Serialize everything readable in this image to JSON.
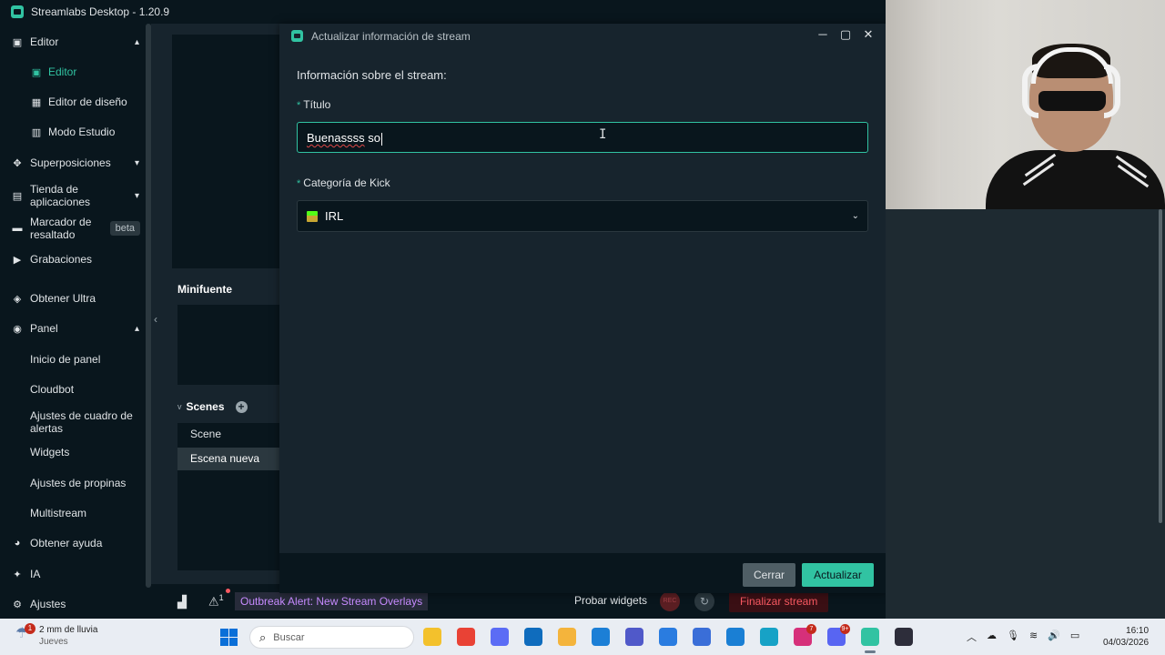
{
  "app": {
    "title": "Streamlabs Desktop - 1.20.9"
  },
  "sidebar": {
    "items": [
      {
        "label": "Editor",
        "icon": "editor-icon",
        "chevron": "▴"
      },
      {
        "label": "Editor",
        "icon": "editor-icon",
        "active": true
      },
      {
        "label": "Editor de diseño",
        "icon": "layout-icon"
      },
      {
        "label": "Modo Estudio",
        "icon": "studio-mode-icon"
      },
      {
        "label": "Superposiciones",
        "icon": "overlays-icon",
        "chevron": "▾"
      },
      {
        "label": "Tienda de aplicaciones",
        "icon": "app-store-icon",
        "chevron": "▾"
      },
      {
        "label": "Marcador de resaltado",
        "icon": "highlighter-icon",
        "badge": "beta"
      },
      {
        "label": "Grabaciones",
        "icon": "recordings-icon"
      },
      {
        "label": "Obtener Ultra",
        "icon": "ultra-icon"
      },
      {
        "label": "Panel",
        "icon": "dashboard-icon",
        "chevron": "▴"
      },
      {
        "label": "Inicio de panel"
      },
      {
        "label": "Cloudbot"
      },
      {
        "label": "Ajustes de cuadro de alertas"
      },
      {
        "label": "Widgets"
      },
      {
        "label": "Ajustes de propinas"
      },
      {
        "label": "Multistream"
      },
      {
        "label": "Obtener ayuda",
        "icon": "help-icon"
      },
      {
        "label": "IA",
        "icon": "ai-sparkle-icon"
      },
      {
        "label": "Ajustes",
        "icon": "settings-gear-icon"
      }
    ]
  },
  "editor": {
    "minifuente_title": "Minifuente",
    "scenes_title": "Scenes",
    "scenes": [
      "Scene",
      "Escena nueva"
    ],
    "selected_scene": "Escena nueva"
  },
  "footer": {
    "alert_count": "1",
    "outbreak_text": "Outbreak Alert: New Stream Overlays",
    "probar_widgets": "Probar widgets",
    "rec_label": "REC",
    "end_stream": "Finalizar stream"
  },
  "modal": {
    "title": "Actualizar información de stream",
    "section_title": "Información sobre el stream:",
    "title_label": "Título",
    "title_value_misspelled": "Buenassss",
    "title_value_rest": " so",
    "category_label": "Categoría de Kick",
    "category_value": "IRL",
    "close_button": "Cerrar",
    "update_button": "Actualizar",
    "required_marker": "*"
  },
  "taskbar": {
    "weather_line1": "2 mm de lluvia",
    "weather_line2": "Jueves",
    "weather_badge": "1",
    "search_placeholder": "Buscar",
    "time": "16:10",
    "date": "04/03/2026",
    "apps": [
      {
        "name": "file-explorer-icon",
        "color": "#f3c12c"
      },
      {
        "name": "chrome-icon",
        "color": "#e94235"
      },
      {
        "name": "copilot-icon",
        "color": "#5b6cf5"
      },
      {
        "name": "outlook-icon",
        "color": "#0f6cbd"
      },
      {
        "name": "folder-icon",
        "color": "#f4b43c"
      },
      {
        "name": "store-icon",
        "color": "#1c7fd6"
      },
      {
        "name": "teams-icon",
        "color": "#5059c9"
      },
      {
        "name": "sync-icon",
        "color": "#2a7ce0"
      },
      {
        "name": "photos-icon",
        "color": "#3a6ed8"
      },
      {
        "name": "vscode-icon",
        "color": "#1a7fd4"
      },
      {
        "name": "edge-icon",
        "color": "#17a2c6"
      },
      {
        "name": "instagram-icon",
        "color": "#d6307a",
        "badge": "7"
      },
      {
        "name": "discord-icon",
        "color": "#5865f2",
        "badge": "9+"
      },
      {
        "name": "streamlabs-icon",
        "color": "#31c3a2"
      },
      {
        "name": "app-icon",
        "color": "#2d2d3a"
      }
    ]
  },
  "colors": {
    "accent": "#31c3a2",
    "danger": "#f85961",
    "bg_dark": "#09161d",
    "bg_panel": "#17242d"
  }
}
